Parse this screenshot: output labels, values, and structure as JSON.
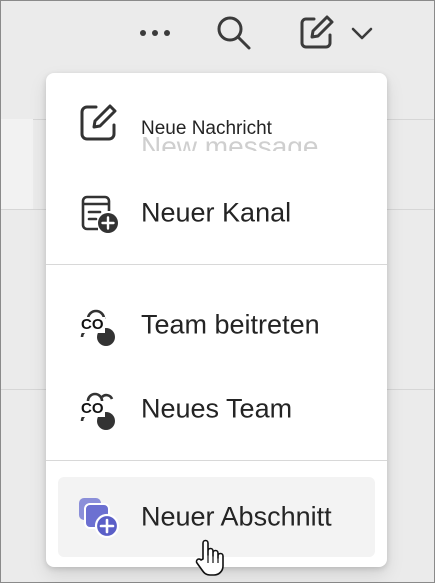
{
  "toolbar": {
    "more_icon": "more-horizontal-icon",
    "search_icon": "search-icon",
    "compose_icon": "compose-icon",
    "chevron_icon": "chevron-down-icon"
  },
  "menu": {
    "items": [
      {
        "label": "Neue Nachricht",
        "ghost_label": "New message",
        "icon": "compose-icon"
      },
      {
        "label": "Neuer Kanal",
        "icon": "channel-add-icon"
      },
      {
        "label": "Team beitreten",
        "icon": "people-team-join-icon",
        "badge": "CO"
      },
      {
        "label": "Neues Team",
        "icon": "people-team-add-icon",
        "badge": "CO"
      },
      {
        "label": "Neuer Abschnitt",
        "icon": "section-add-icon"
      }
    ]
  },
  "colors": {
    "accent": "#5b5fc7",
    "menu_bg": "#ffffff",
    "hover_bg": "#f3f3f3",
    "app_bg": "#ebebeb"
  }
}
